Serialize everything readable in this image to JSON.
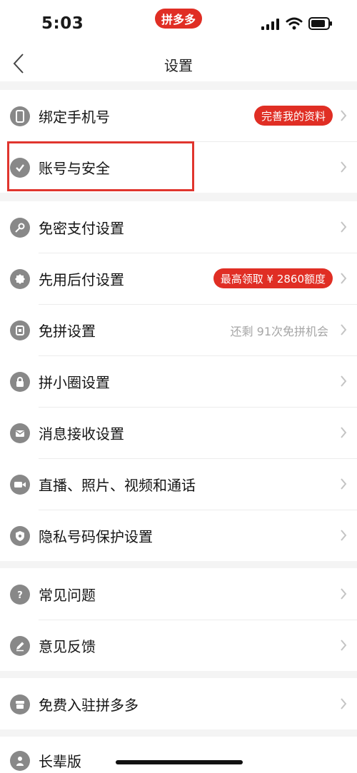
{
  "status_bar": {
    "time": "5:03",
    "app_badge": "拼多多"
  },
  "header": {
    "title": "设置"
  },
  "groups": [
    {
      "items": [
        {
          "label": "绑定手机号",
          "badge": "完善我的资料"
        },
        {
          "label": "账号与安全"
        }
      ]
    },
    {
      "items": [
        {
          "label": "免密支付设置"
        },
        {
          "label": "先用后付设置",
          "badge": "最高领取 ¥ 2860额度"
        },
        {
          "label": "免拼设置",
          "value": "还剩 91次免拼机会"
        },
        {
          "label": "拼小圈设置"
        },
        {
          "label": "消息接收设置"
        },
        {
          "label": "直播、照片、视频和通话"
        },
        {
          "label": "隐私号码保护设置"
        }
      ]
    },
    {
      "items": [
        {
          "label": "常见问题"
        },
        {
          "label": "意见反馈"
        }
      ]
    },
    {
      "items": [
        {
          "label": "免费入驻拼多多"
        }
      ]
    },
    {
      "items": [
        {
          "label": "长辈版"
        }
      ]
    }
  ],
  "icons": {
    "phone": "phone-icon",
    "account": "shield-icon",
    "password_free": "key-icon",
    "pay_later": "badge-icon",
    "free_group": "card-icon",
    "circle": "lock-icon",
    "messages": "mail-icon",
    "media": "video-icon",
    "privacy": "privacy-shield-icon",
    "faq": "question-icon",
    "feedback": "pencil-icon",
    "merchant": "store-icon",
    "elder": "elder-icon"
  },
  "colors": {
    "accent": "#e02e24",
    "icon_gray": "#888888",
    "highlight": "#e0352e"
  }
}
